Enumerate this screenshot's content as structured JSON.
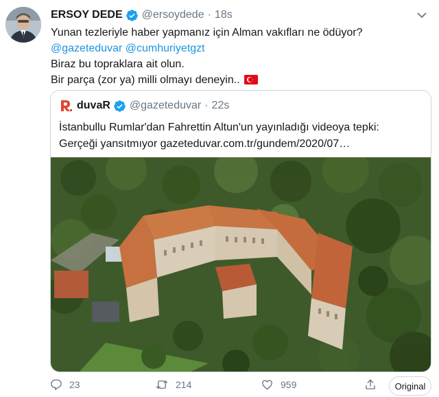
{
  "author": {
    "name": "ERSOY DEDE",
    "handle": "@ersoydede",
    "separator": "·",
    "time": "18s"
  },
  "tweet": {
    "line1": "Yunan tezleriyle haber yapmanız için Alman vakıfları ne ödüyor?",
    "mention1": "@gazeteduvar",
    "mention2": "@cumhuriyetgzt",
    "line3": "Biraz bu topraklara ait olun.",
    "line4": "Bir parça (zor ya) milli olmayı deneyin..",
    "flag_icon": "turkey-flag-icon"
  },
  "quote": {
    "name": "duvaR",
    "handle": "@gazeteduvar",
    "separator": "·",
    "time": "22s",
    "text_line1": "İstanbullu Rumlar'dan Fahrettin Altun'un yayınladığı videoya tepki:",
    "text_line2": "Gerçeği yansıtmıyor  gazeteduvar.com.tr/gundem/2020/07…",
    "logo_color": "#e0452c"
  },
  "actions": {
    "reply_count": "23",
    "retweet_count": "214",
    "like_count": "959",
    "original_label": "Original"
  },
  "colors": {
    "link": "#1b95e0",
    "verified": "#1da1f2",
    "secondary_text": "#657786"
  }
}
